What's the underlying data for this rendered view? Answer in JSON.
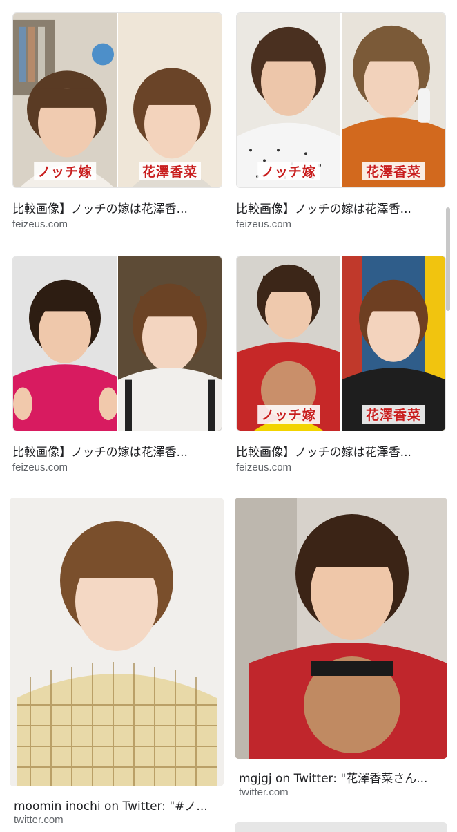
{
  "results": [
    {
      "title": "比較画像】ノッチの嫁は花澤香...",
      "source": "feizeus.com",
      "tags": [
        "ノッチ嫁",
        "花澤香菜"
      ]
    },
    {
      "title": "比較画像】ノッチの嫁は花澤香...",
      "source": "feizeus.com",
      "tags": [
        "ノッチ嫁",
        "花澤香菜"
      ]
    },
    {
      "title": "比較画像】ノッチの嫁は花澤香...",
      "source": "feizeus.com",
      "tags": []
    },
    {
      "title": "比較画像】ノッチの嫁は花澤香...",
      "source": "feizeus.com",
      "tags": [
        "ノッチ嫁",
        "花澤香菜"
      ]
    },
    {
      "title": "moomin inochi on Twitter: \"#ノ...",
      "source": "twitter.com",
      "tags": []
    },
    {
      "title": "mgjgj on Twitter: \"花澤香菜さん...",
      "source": "twitter.com",
      "tags": []
    }
  ],
  "colors": {
    "title_text": "#202124",
    "source_text": "#5f6368",
    "tag_text": "#c81d1d",
    "scrollbar": "#c8c8c8"
  },
  "icons": {
    "scroll_indicator": "scrollbar-thumb"
  }
}
